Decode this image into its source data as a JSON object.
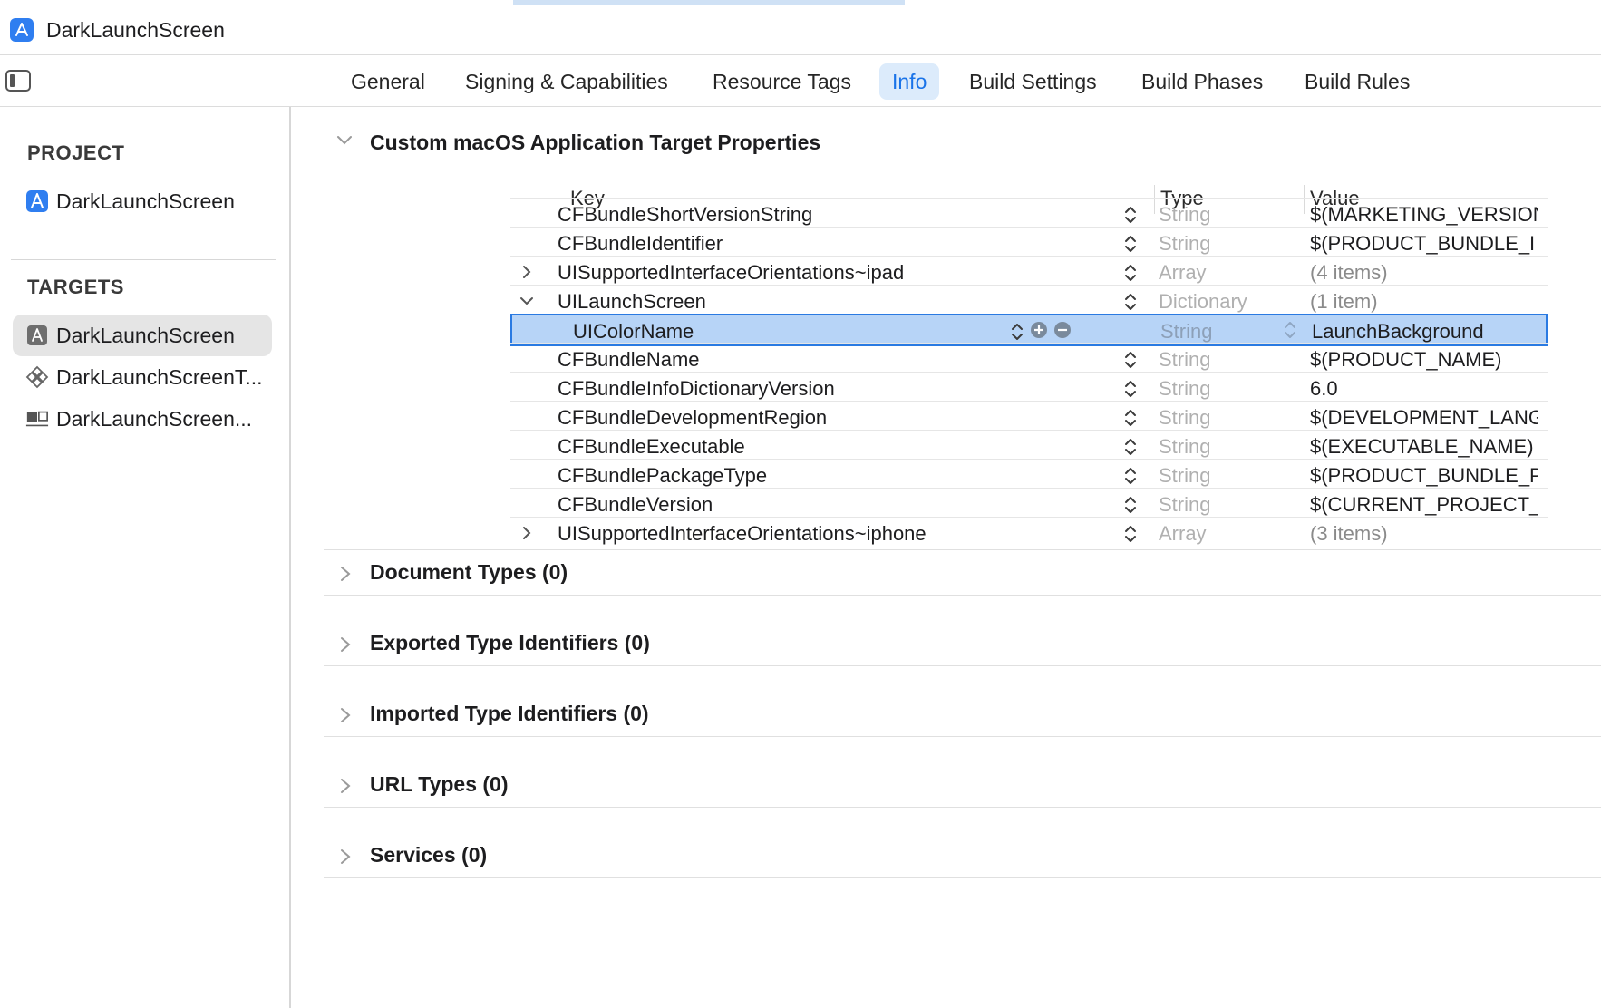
{
  "window": {
    "title": "DarkLaunchScreen"
  },
  "tabs": [
    {
      "label": "General"
    },
    {
      "label": "Signing & Capabilities"
    },
    {
      "label": "Resource Tags"
    },
    {
      "label": "Info",
      "active": true
    },
    {
      "label": "Build Settings"
    },
    {
      "label": "Build Phases"
    },
    {
      "label": "Build Rules"
    }
  ],
  "sidebar": {
    "project_header": "PROJECT",
    "project_item": "DarkLaunchScreen",
    "targets_header": "TARGETS",
    "targets": [
      {
        "label": "DarkLaunchScreen",
        "icon": "app-target-icon",
        "selected": true
      },
      {
        "label": "DarkLaunchScreenT...",
        "icon": "test-target-icon"
      },
      {
        "label": "DarkLaunchScreen...",
        "icon": "ui-test-target-icon"
      }
    ]
  },
  "main": {
    "properties_title": "Custom macOS Application Target Properties",
    "columns": {
      "key": "Key",
      "type": "Type",
      "value": "Value"
    },
    "rows": [
      {
        "key": "CFBundleShortVersionString",
        "type": "String",
        "value": "$(MARKETING_VERSION"
      },
      {
        "key": "CFBundleIdentifier",
        "type": "String",
        "value": "$(PRODUCT_BUNDLE_I"
      },
      {
        "key": "UISupportedInterfaceOrientations~ipad",
        "type": "Array",
        "value": "(4 items)",
        "expandable": "collapsed"
      },
      {
        "key": "UILaunchScreen",
        "type": "Dictionary",
        "value": "(1 item)",
        "expandable": "expanded"
      },
      {
        "key": "UIColorName",
        "type": "String",
        "value": "LaunchBackground",
        "selected": true,
        "indent": true
      },
      {
        "key": "CFBundleName",
        "type": "String",
        "value": "$(PRODUCT_NAME)"
      },
      {
        "key": "CFBundleInfoDictionaryVersion",
        "type": "String",
        "value": "6.0"
      },
      {
        "key": "CFBundleDevelopmentRegion",
        "type": "String",
        "value": "$(DEVELOPMENT_LANG"
      },
      {
        "key": "CFBundleExecutable",
        "type": "String",
        "value": "$(EXECUTABLE_NAME)"
      },
      {
        "key": "CFBundlePackageType",
        "type": "String",
        "value": "$(PRODUCT_BUNDLE_P"
      },
      {
        "key": "CFBundleVersion",
        "type": "String",
        "value": "$(CURRENT_PROJECT_"
      },
      {
        "key": "UISupportedInterfaceOrientations~iphone",
        "type": "Array",
        "value": "(3 items)",
        "expandable": "collapsed"
      }
    ],
    "sections": [
      {
        "title": "Document Types (0)"
      },
      {
        "title": "Exported Type Identifiers (0)"
      },
      {
        "title": "Imported Type Identifiers (0)"
      },
      {
        "title": "URL Types (0)"
      },
      {
        "title": "Services (0)"
      }
    ]
  },
  "colors": {
    "accent": "#1a73e8",
    "selection": "#b7d4f7",
    "selection_border": "#2a7ae2",
    "tab_active_bg": "#dcebfb"
  }
}
